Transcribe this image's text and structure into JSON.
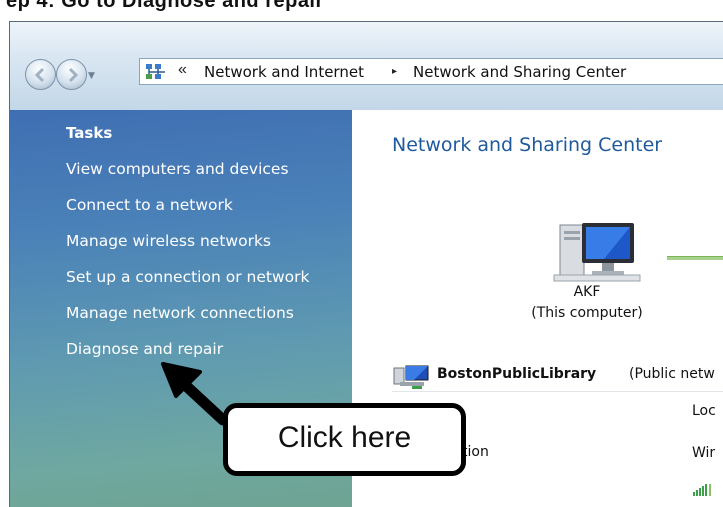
{
  "header_fragment": "ep 4: Go to Diagnose and repair",
  "address_bar": {
    "overflow_chevrons": "«",
    "crumbs": [
      "Network and Internet",
      "Network and Sharing Center"
    ],
    "separator": "▸"
  },
  "sidebar": {
    "heading": "Tasks",
    "items": [
      {
        "label": "View computers and devices"
      },
      {
        "label": "Connect to a network"
      },
      {
        "label": "Manage wireless networks"
      },
      {
        "label": "Set up a connection or network"
      },
      {
        "label": "Manage network connections"
      },
      {
        "label": "Diagnose and repair"
      }
    ]
  },
  "main": {
    "title": "Network and Sharing Center",
    "computer": {
      "name": "AKF",
      "subtitle": "(This computer)"
    },
    "network": {
      "name": "BostonPublicLibrary",
      "type": "(Public netw"
    },
    "fields": {
      "access_label_fragment": "tion",
      "location_fragment": "Loc",
      "connection_fragment": "Wir"
    }
  },
  "callout": {
    "text": "Click here"
  },
  "colors": {
    "sidebar_top": "#3f6fb3",
    "sidebar_bottom": "#6ea392",
    "title_blue": "#1e5a9c",
    "sidebar_text": "#ffffff"
  },
  "icons": {
    "back": "back-arrow-icon",
    "forward": "forward-arrow-icon",
    "network_folder": "network-folder-icon",
    "computer": "computer-icon",
    "network": "network-icon",
    "signal": "signal-bars-icon"
  }
}
